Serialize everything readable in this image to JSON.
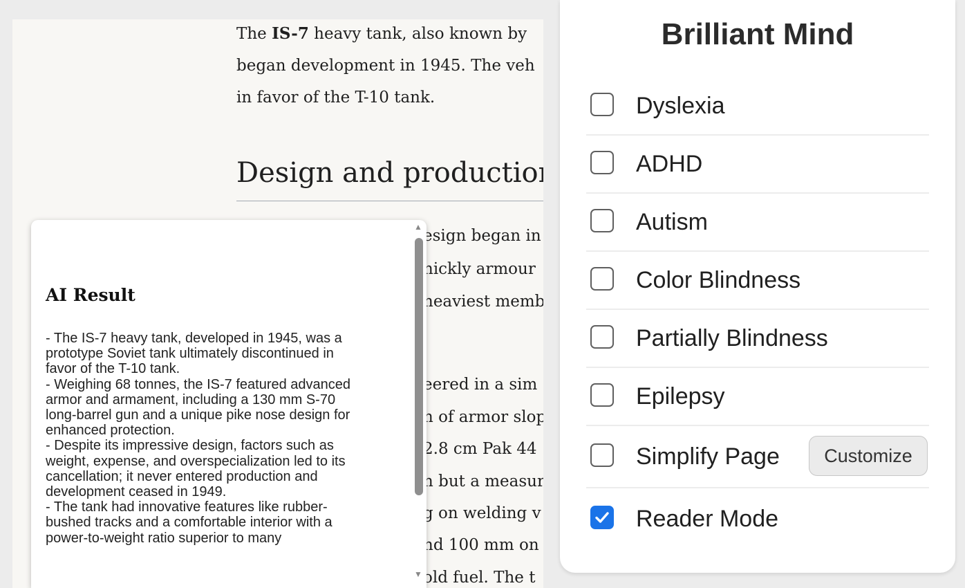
{
  "article": {
    "intro_lines": [
      [
        "The ",
        "IS-7",
        " heavy tank, also known by"
      ],
      [
        "began development in 1945. The veh",
        "",
        ""
      ],
      [
        "in favor of the T-10 tank.",
        "",
        ""
      ]
    ],
    "heading": "Design and production",
    "fragments": [
      "esign began in",
      "hickly armour",
      "heaviest memb",
      "eered in a sim",
      "n of armor slop",
      "2.8 cm Pak 44",
      "n but a measur",
      "g on welding v",
      "nd 100 mm on",
      "old fuel. The t"
    ]
  },
  "ai_popup": {
    "title": "AI Result",
    "lines": [
      "- The IS-7 heavy tank, developed in 1945, was a",
      "prototype Soviet tank ultimately discontinued in",
      "favor of the T-10 tank.",
      "- Weighing 68 tonnes, the IS-7 featured advanced",
      "armor and armament, including a 130 mm S-70",
      "long-barrel gun and a unique pike nose design for",
      "enhanced protection.",
      "- Despite its impressive design, factors such as",
      "weight, expense, and overspecialization led to its",
      "cancellation; it never entered production and",
      "development ceased in 1949.",
      "- The tank had innovative features like rubber-",
      "bushed tracks and a comfortable interior with a",
      "power-to-weight ratio superior to many"
    ],
    "scroll_up": "▲",
    "scroll_down": "▼"
  },
  "panel": {
    "title": "Brilliant Mind",
    "options": [
      {
        "label": "Dyslexia",
        "checked": false
      },
      {
        "label": "ADHD",
        "checked": false
      },
      {
        "label": "Autism",
        "checked": false
      },
      {
        "label": "Color Blindness",
        "checked": false
      },
      {
        "label": "Partially Blindness",
        "checked": false
      },
      {
        "label": "Epilepsy",
        "checked": false
      },
      {
        "label": "Simplify Page",
        "checked": false
      },
      {
        "label": "Reader Mode",
        "checked": true
      }
    ],
    "customize_label": "Customize",
    "accent_color": "#1a73e8"
  }
}
